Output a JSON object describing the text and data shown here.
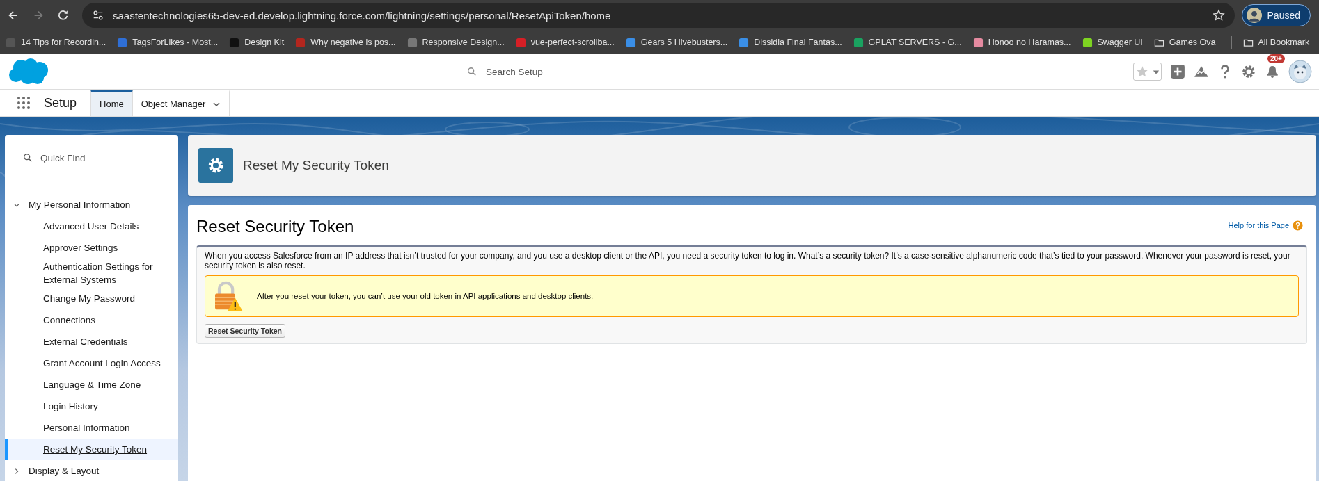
{
  "browser": {
    "url": "saastentechnologies65-dev-ed.develop.lightning.force.com/lightning/settings/personal/ResetApiToken/home",
    "profile_button": "Paused",
    "bookmarks": [
      {
        "label": "14 Tips for Recordin...",
        "kind": "site"
      },
      {
        "label": "TagsForLikes - Most...",
        "kind": "site"
      },
      {
        "label": "Design Kit",
        "kind": "site"
      },
      {
        "label": "Why negative is pos...",
        "kind": "site"
      },
      {
        "label": "Responsive Design...",
        "kind": "site"
      },
      {
        "label": "vue-perfect-scrollba...",
        "kind": "site"
      },
      {
        "label": "Gears 5 Hivebusters...",
        "kind": "site"
      },
      {
        "label": "Dissidia Final Fantas...",
        "kind": "site"
      },
      {
        "label": "GPLAT SERVERS - G...",
        "kind": "site"
      },
      {
        "label": "Honoo no Haramas...",
        "kind": "site"
      },
      {
        "label": "Swagger UI",
        "kind": "site"
      },
      {
        "label": "Games Ova",
        "kind": "folder"
      }
    ],
    "all_bookmarks": "All Bookmark"
  },
  "header": {
    "search": {
      "placeholder": "Search Setup"
    },
    "notification_badge": "20+"
  },
  "nav": {
    "app_name": "Setup",
    "tabs": [
      {
        "label": "Home",
        "selected": true,
        "dropdown": false
      },
      {
        "label": "Object Manager",
        "selected": false,
        "dropdown": true
      }
    ]
  },
  "sidebar": {
    "quick_find": {
      "placeholder": "Quick Find"
    },
    "tree": [
      {
        "label": "My Personal Information",
        "expanded": true,
        "children": [
          {
            "label": "Advanced User Details",
            "selected": false
          },
          {
            "label": "Approver Settings",
            "selected": false
          },
          {
            "label": "Authentication Settings for External Systems",
            "selected": false
          },
          {
            "label": "Change My Password",
            "selected": false
          },
          {
            "label": "Connections",
            "selected": false
          },
          {
            "label": "External Credentials",
            "selected": false
          },
          {
            "label": "Grant Account Login Access",
            "selected": false
          },
          {
            "label": "Language & Time Zone",
            "selected": false
          },
          {
            "label": "Login History",
            "selected": false
          },
          {
            "label": "Personal Information",
            "selected": false
          },
          {
            "label": "Reset My Security Token",
            "selected": true
          }
        ]
      },
      {
        "label": "Display & Layout",
        "expanded": false
      }
    ]
  },
  "page_header": {
    "title": "Reset My Security Token"
  },
  "content": {
    "heading": "Reset Security Token",
    "help_link": "Help for this Page",
    "description": "When you access Salesforce from an IP address that isn’t trusted for your company, and you use a desktop client or the API, you need a security token to log in. What’s a security token? It’s a case-sensitive alphanumeric code that’s tied to your password. Whenever your password is reset, your security token is also reset.",
    "warning": "After you reset your token, you can’t use your old token in API applications and desktop clients.",
    "button": "Reset Security Token"
  }
}
